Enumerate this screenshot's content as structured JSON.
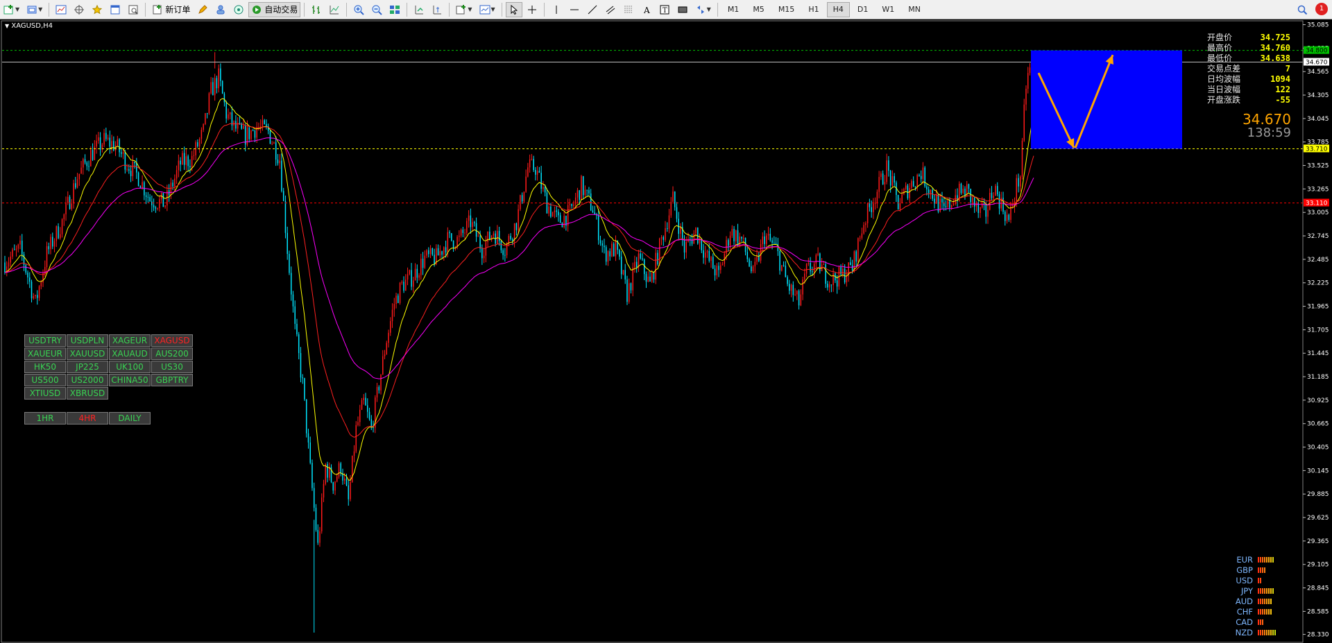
{
  "toolbar": {
    "new_order_label": "新订单",
    "auto_trade_label": "自动交易",
    "timeframes": [
      "M1",
      "M5",
      "M15",
      "H1",
      "H4",
      "D1",
      "W1",
      "MN"
    ],
    "active_timeframe": "H4",
    "notification_count": "1"
  },
  "chart": {
    "symbol_title": "XAGUSD,H4",
    "price_axis_labels": [
      "35.085",
      "34.825",
      "34.565",
      "34.305",
      "34.045",
      "33.785",
      "33.525",
      "33.265",
      "33.005",
      "32.745",
      "32.485",
      "32.225",
      "31.965",
      "31.705",
      "31.445",
      "31.185",
      "30.925",
      "30.665",
      "30.405",
      "30.145",
      "29.885",
      "29.625",
      "29.365",
      "29.105",
      "28.845",
      "28.585",
      "28.330"
    ],
    "price_tags": [
      {
        "value": "34.800",
        "color": "#00c000",
        "text_color": "#000000"
      },
      {
        "value": "34.670",
        "color": "#ffffff",
        "text_color": "#000000"
      },
      {
        "value": "33.710",
        "color": "#ffff00",
        "text_color": "#000000"
      },
      {
        "value": "33.110",
        "color": "#ff0000",
        "text_color": "#ffffff"
      }
    ],
    "colors": {
      "bull": "#ff1a1a",
      "bear": "#00e5ff",
      "ma_fast": "#ffff00",
      "ma_mid": "#ff2020",
      "ma_slow": "#ff00ff",
      "zone": "#0000ff",
      "arrow": "#ffa500"
    },
    "price_range": [
      28.25,
      35.12
    ]
  },
  "info_panel": {
    "rows": [
      {
        "label": "开盘价",
        "value": "34.725"
      },
      {
        "label": "最高价",
        "value": "34.760"
      },
      {
        "label": "最低价",
        "value": "34.638"
      },
      {
        "label": "交易点差",
        "value": "7"
      },
      {
        "label": "日均波幅",
        "value": "1094"
      },
      {
        "label": "当日波幅",
        "value": "122"
      },
      {
        "label": "开盘涨跌",
        "value": "-55"
      }
    ],
    "current_price": "34.670",
    "timer": "138:59"
  },
  "symbols": [
    "USDTRY",
    "USDPLN",
    "XAGEUR",
    "XAGUSD",
    "XAUEUR",
    "XAUUSD",
    "XAUAUD",
    "AUS200",
    "HK50",
    "JP225",
    "UK100",
    "US30",
    "US500",
    "US2000",
    "CHINA50",
    "GBPTRY",
    "XTIUSD",
    "XBRUSD"
  ],
  "selected_symbol": "XAGUSD",
  "timeframe_buttons": [
    "1HR",
    "4HR",
    "DAILY"
  ],
  "selected_timeframe_button": "4HR",
  "currency_strength": [
    {
      "name": "EUR",
      "level": 8
    },
    {
      "name": "GBP",
      "level": 4
    },
    {
      "name": "USD",
      "level": 2
    },
    {
      "name": "JPY",
      "level": 8
    },
    {
      "name": "AUD",
      "level": 7
    },
    {
      "name": "CHF",
      "level": 7
    },
    {
      "name": "CAD",
      "level": 3
    },
    {
      "name": "NZD",
      "level": 9
    }
  ]
}
